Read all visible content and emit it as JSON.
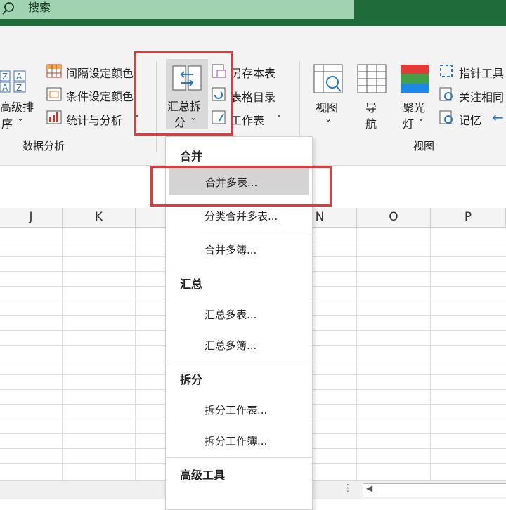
{
  "search": {
    "label": "搜索"
  },
  "ribbon": {
    "sort": {
      "line1": "高级排",
      "line2": "序"
    },
    "interval_color": "间隔设定颜色",
    "cond_color": "条件设定颜色",
    "stats": "统计与分析",
    "group_data_analysis": "数据分析",
    "summary_split": {
      "line1": "汇总拆",
      "line2": "分"
    },
    "save_sheet": "另存本表",
    "sheet_dir": "表格目录",
    "worksheet": "工作表",
    "view_btn": "视图",
    "nav": {
      "line1": "导",
      "line2": "航"
    },
    "spotlight": {
      "line1": "聚光",
      "line2": "灯"
    },
    "pointer_tool": "指针工具",
    "focus_same": "关注相同",
    "memory": "记忆",
    "group_view": "视图"
  },
  "columns": [
    "J",
    "K",
    "",
    "",
    "N",
    "O",
    "P"
  ],
  "menu": {
    "merge_header": "合并",
    "merge_sheets": "合并多表...",
    "classify_merge": "分类合并多表...",
    "merge_books": "合并多簿...",
    "summary_header": "汇总",
    "summary_sheets": "汇总多表...",
    "summary_books": "汇总多簿...",
    "split_header": "拆分",
    "split_worksheet": "拆分工作表...",
    "split_workbook": "拆分工作簿...",
    "advanced_header": "高级工具"
  },
  "colors": {
    "highlight": "#e23a3a",
    "topbar": "#1f6b3a",
    "search": "#9fd3b2"
  }
}
